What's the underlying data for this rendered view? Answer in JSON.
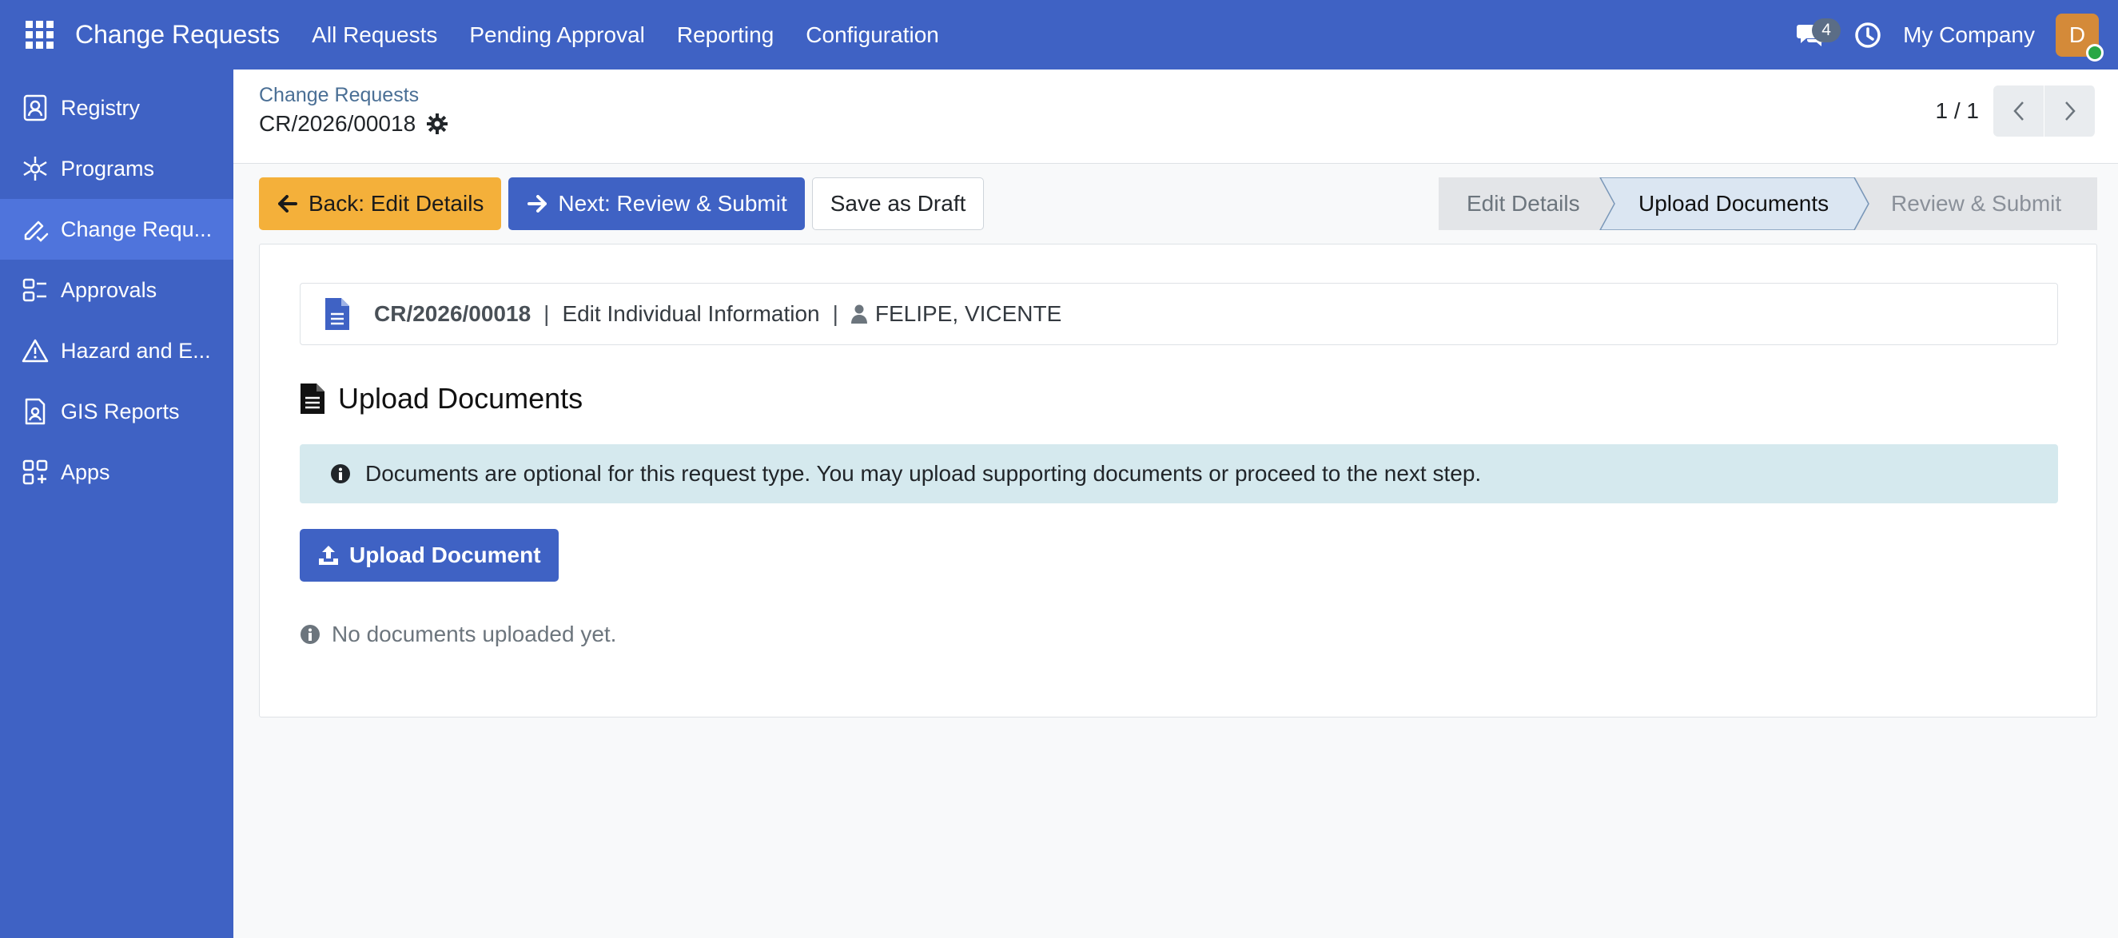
{
  "topbar": {
    "app_title": "Change Requests",
    "menu": [
      "All Requests",
      "Pending Approval",
      "Reporting",
      "Configuration"
    ],
    "chat_count": "4",
    "company": "My Company",
    "avatar_letter": "D"
  },
  "sidebar": {
    "items": [
      {
        "label": "Registry",
        "icon": "registry-icon"
      },
      {
        "label": "Programs",
        "icon": "programs-icon"
      },
      {
        "label": "Change Requ...",
        "icon": "change-request-icon"
      },
      {
        "label": "Approvals",
        "icon": "approvals-icon"
      },
      {
        "label": "Hazard and E...",
        "icon": "hazard-icon"
      },
      {
        "label": "GIS Reports",
        "icon": "gis-icon"
      },
      {
        "label": "Apps",
        "icon": "apps-icon"
      }
    ],
    "active_index": 2
  },
  "control": {
    "breadcrumb": "Change Requests",
    "record": "CR/2026/00018",
    "pager": "1 / 1"
  },
  "actions": {
    "back": "Back: Edit Details",
    "next": "Next: Review & Submit",
    "draft": "Save as Draft"
  },
  "steps": [
    {
      "label": "Edit Details",
      "state": "done"
    },
    {
      "label": "Upload Documents",
      "state": "current"
    },
    {
      "label": "Review & Submit",
      "state": "todo"
    }
  ],
  "info_card": {
    "code": "CR/2026/00018",
    "sep": "|",
    "type": "Edit Individual Information",
    "person": "FELIPE, VICENTE"
  },
  "section": {
    "title": "Upload Documents",
    "alert": "Documents are optional for this request type. You may upload supporting documents or proceed to the next step.",
    "upload_button": "Upload Document",
    "empty_note": "No documents uploaded yet."
  },
  "colors": {
    "brand": "#3f62c4",
    "warning": "#f4b03a",
    "alert_bg": "#d5e9ee"
  }
}
